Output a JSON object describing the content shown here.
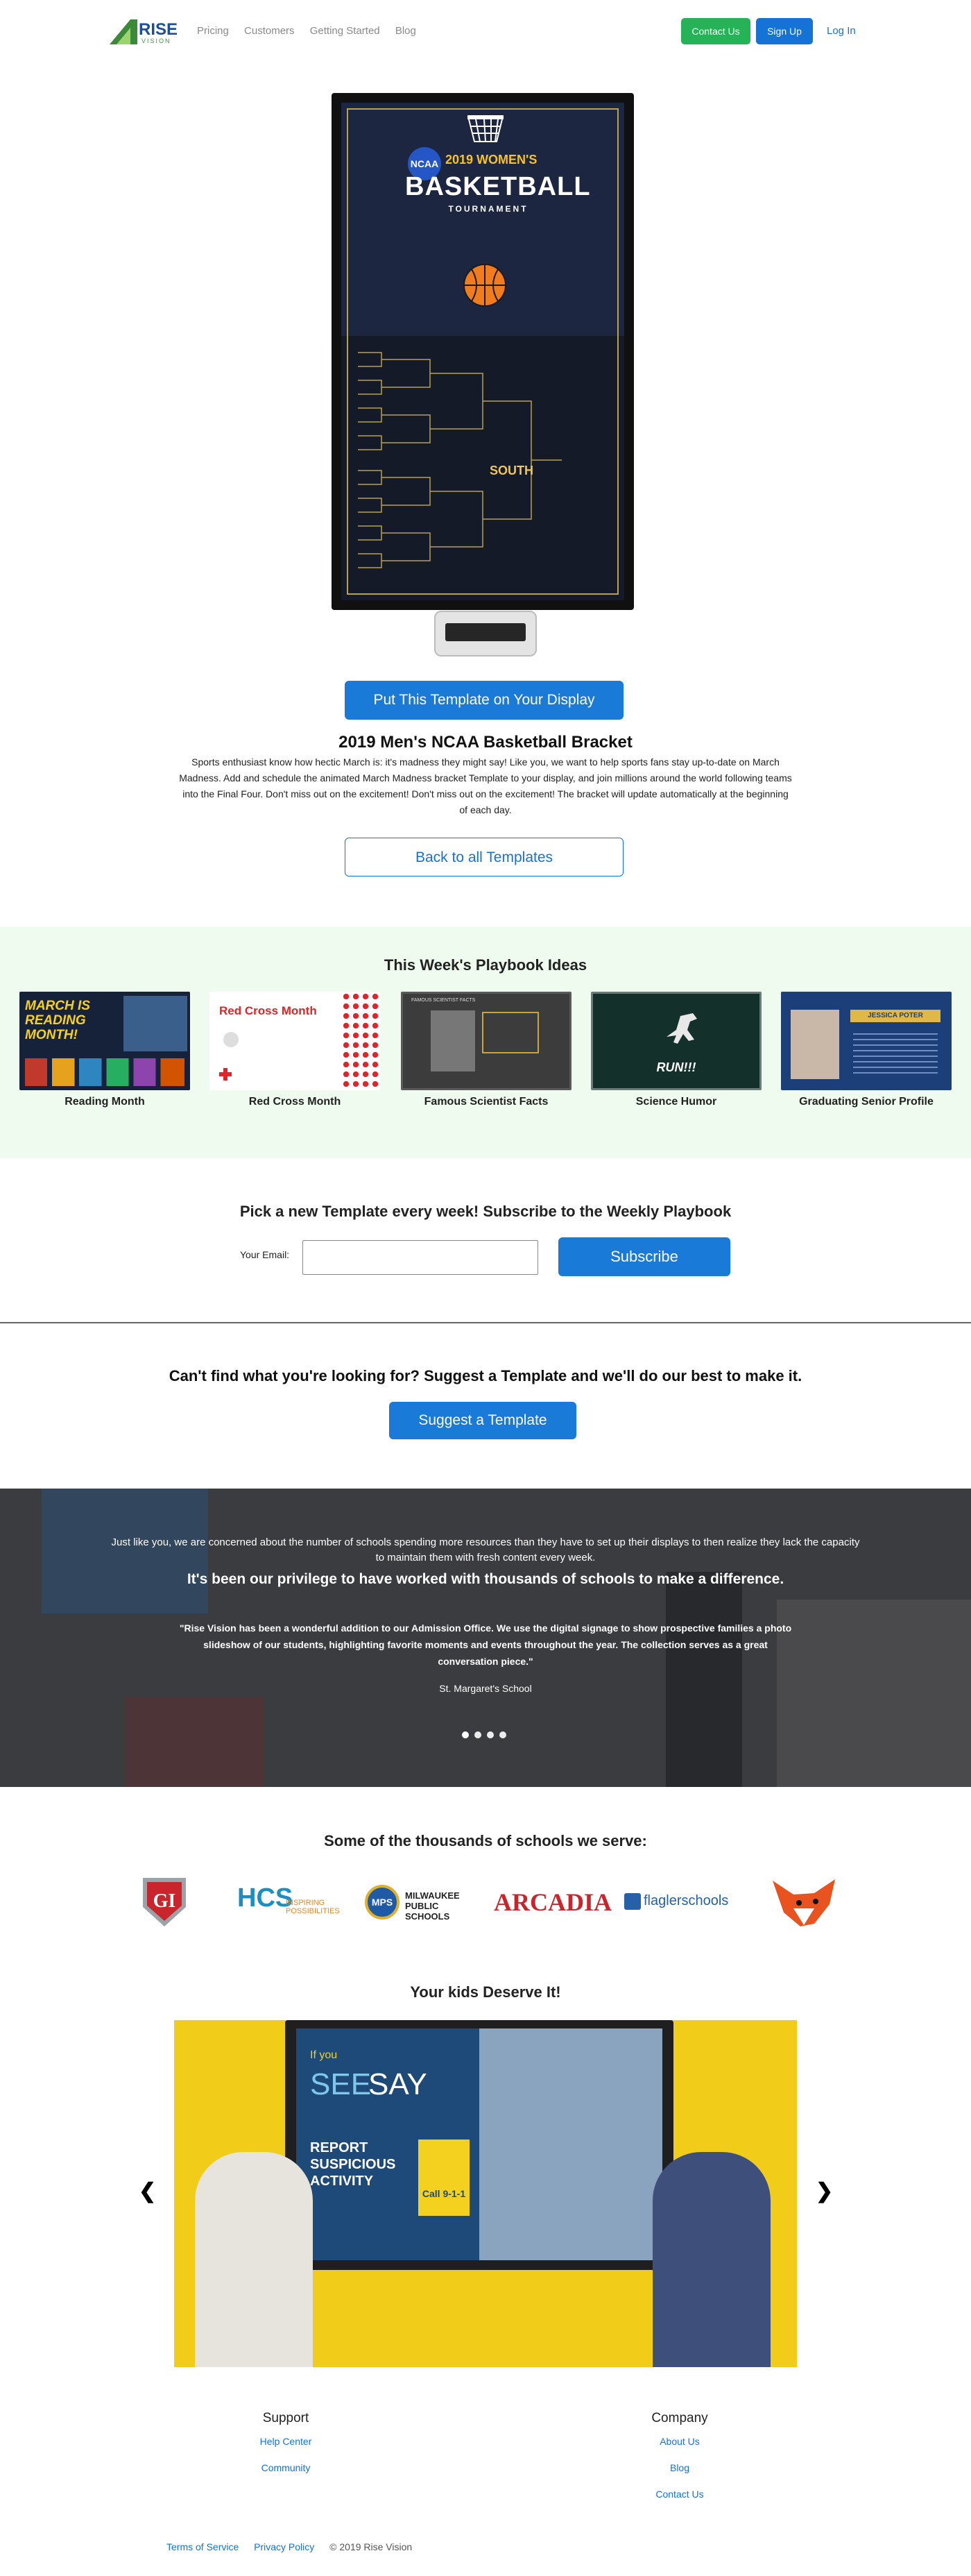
{
  "header": {
    "logo_text": "RISE",
    "logo_sub": "VISION",
    "nav": [
      "Pricing",
      "Customers",
      "Getting Started",
      "Blog"
    ],
    "contact_label": "Contact Us",
    "signup_label": "Sign Up",
    "login_label": "Log In"
  },
  "hero": {
    "badge": "NCAA",
    "year_text": "2019 WOMEN'S",
    "big_text": "BASKETBALL",
    "small_text": "TOURNAMENT",
    "region": "SOUTH"
  },
  "template": {
    "put_label": "Put This Template on Your Display",
    "title": "2019 Men's NCAA Basketball Bracket",
    "description": "Sports enthusiast know how hectic March is: it's madness they might say! Like you, we want to help sports fans stay up-to-date on March Madness. Add and schedule the animated March Madness bracket Template to your display, and join millions around the world following teams into the Final Four. Don't miss out on the excitement! Don't miss out on the excitement! The bracket will update automatically at the beginning of each day.",
    "back_label": "Back to all Templates"
  },
  "playbook": {
    "title": "This Week's Playbook Ideas",
    "cards": [
      {
        "caption": "Reading Month",
        "thumb_title": "MARCH IS READING MONTH!"
      },
      {
        "caption": "Red Cross Month",
        "thumb_title": "Red Cross Month"
      },
      {
        "caption": "Famous Scientist Facts",
        "thumb_title": "FAMOUS SCIENTIST FACTS"
      },
      {
        "caption": "Science Humor",
        "thumb_title": "RUN!!!"
      },
      {
        "caption": "Graduating Senior Profile",
        "thumb_title": "JESSICA POTER"
      }
    ]
  },
  "subscribe": {
    "title": "Pick a new Template every week! Subscribe to the Weekly Playbook",
    "email_label": "Your Email:",
    "email_value": "",
    "button_label": "Subscribe"
  },
  "suggest": {
    "title": "Can't find what you're looking for? Suggest a Template and we'll do our best to make it.",
    "button_label": "Suggest a Template"
  },
  "testimonial": {
    "intro": "Just like you, we are concerned about the number of schools spending more resources than they have to set up their displays to then realize they lack the capacity to maintain them with fresh content every week.",
    "headline": "It's been our privilege to have worked with thousands of schools to make a difference.",
    "quote": "\"Rise Vision has been a wonderful addition to our Admission Office. We use the digital signage to show prospective families a photo slideshow of our students, highlighting favorite moments and events throughout the year. The collection serves as a great conversation piece.\"",
    "author": "St. Margaret's School",
    "slide_count": 4,
    "active_slide": 1
  },
  "schools": {
    "title": "Some of the thousands of schools we serve:",
    "logos": [
      "GI",
      "HCS",
      "MPS",
      "ARCADIA",
      "flaglerschools",
      "fox"
    ],
    "hcs_sub": "INSPIRING POSSIBILITIES",
    "mps_text": "MILWAUKEE PUBLIC SCHOOLS"
  },
  "kids": {
    "title": "Your kids Deserve It!",
    "sign_if": "If you",
    "sign_see": "SEE",
    "sign_say": "SAY",
    "sign_report": "REPORT SUSPICIOUS ACTIVITY",
    "sign_call": "Call 9-1-1"
  },
  "footer": {
    "support_title": "Support",
    "support_links": [
      "Help Center",
      "Community"
    ],
    "company_title": "Company",
    "company_links": [
      "About Us",
      "Blog",
      "Contact Us"
    ],
    "legal": [
      "Terms of Service",
      "Privacy Policy",
      "© 2019 Rise Vision"
    ]
  },
  "colors": {
    "accent": "#1a7ad8",
    "green": "#26b257",
    "playbook_bg": "#eefbee"
  }
}
